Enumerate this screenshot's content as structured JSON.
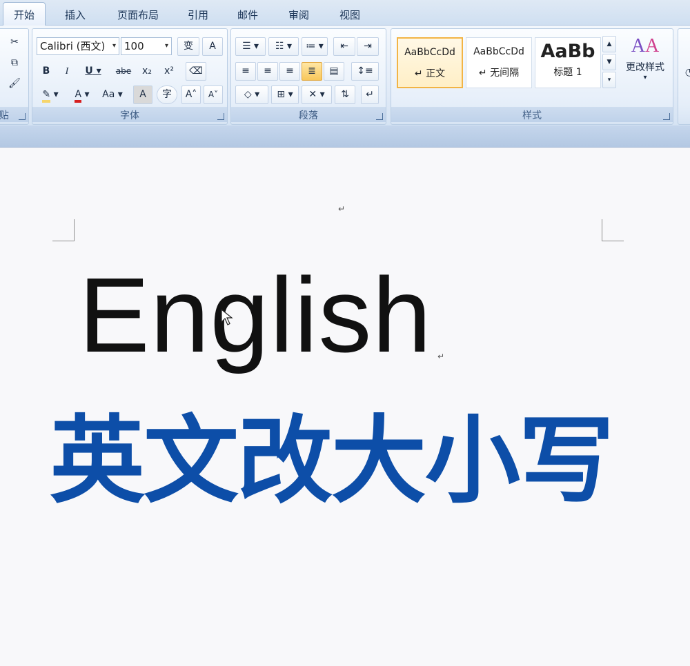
{
  "tabs": [
    {
      "label": "开始",
      "active": true
    },
    {
      "label": "插入"
    },
    {
      "label": "页面布局"
    },
    {
      "label": "引用"
    },
    {
      "label": "邮件"
    },
    {
      "label": "审阅"
    },
    {
      "label": "视图"
    }
  ],
  "ribbon": {
    "clipboard": {
      "label": "贴"
    },
    "font": {
      "label": "字体",
      "font_name": "Calibri (西文)",
      "font_size": "100",
      "bold": "B",
      "italic": "I",
      "underline": "U",
      "strike": "abe",
      "subscript": "x₂",
      "superscript": "x²",
      "change_case": "Aa",
      "grow": "A",
      "shrink": "A"
    },
    "paragraph": {
      "label": "段落"
    },
    "styles": {
      "label": "样式",
      "items": [
        {
          "sample": "AaBbCcDd",
          "name": "正文",
          "selected": true
        },
        {
          "sample": "AaBbCcDd",
          "name": "无间隔"
        },
        {
          "sample": "AaBb",
          "name": "标题 1"
        }
      ],
      "change_styles": "更改样式"
    }
  },
  "document": {
    "word": "English",
    "headline": "英文改大小写"
  },
  "colors": {
    "headline": "#0d4ea8",
    "tab_text": "#1b3557",
    "highlight": "#f6d56b",
    "font_color": "#d62020"
  }
}
